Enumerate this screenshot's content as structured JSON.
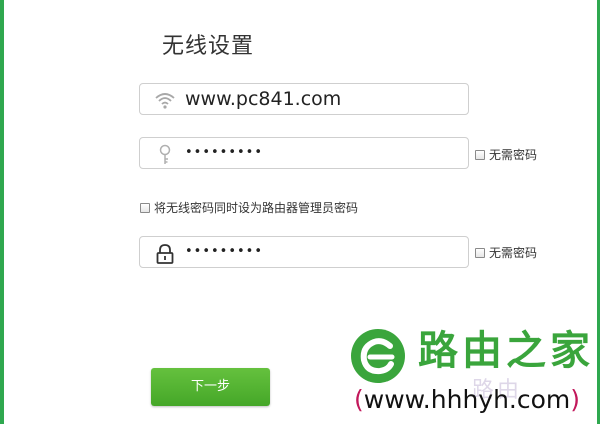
{
  "page": {
    "title": "无线设置"
  },
  "wifi_name": {
    "value": "www.pc841.com"
  },
  "wifi_password": {
    "value": "•••••••••",
    "no_password_label": "无需密码"
  },
  "sync_option": {
    "label": "将无线密码同时设为路由器管理员密码"
  },
  "admin_password": {
    "value": "•••••••••",
    "no_password_label": "无需密码"
  },
  "buttons": {
    "next": "下一步"
  },
  "watermark": {
    "brand": "路由之家",
    "url_open": "(",
    "url": "www.hhhyh.com",
    "url_close": ")",
    "faint_text": "路由"
  },
  "colors": {
    "accent": "#4cb030",
    "edge": "#2fa84f",
    "brand": "#3aa53c"
  },
  "icons": {
    "wifi_field": "wifi-icon",
    "password_field": "key-icon",
    "admin_field": "lock-icon",
    "logo": "brand-logo-icon"
  }
}
